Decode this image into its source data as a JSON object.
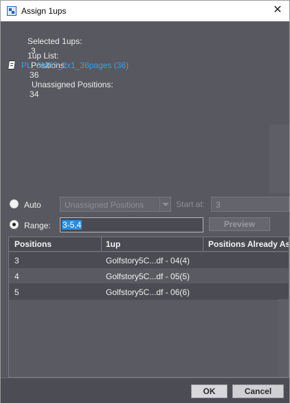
{
  "window": {
    "title": "Assign 1ups",
    "close_glyph": "✕"
  },
  "info": {
    "selected_label": "Selected 1ups:",
    "selected_value": "3",
    "list_label": "1up List:",
    "positions_label": "Positions:",
    "positions_value": "36",
    "unassigned_label": "Unassigned Positions:",
    "unassigned_value": "34"
  },
  "document_link": {
    "text": "PL_SM52_2x1_36pages (36)",
    "icon": "document-icon"
  },
  "auto": {
    "label": "Auto",
    "selected": false,
    "combo_value": "Unassigned Positions",
    "start_at_label": "Start at:",
    "start_at_value": "3"
  },
  "range": {
    "label": "Range:",
    "selected": true,
    "value": "3-5,4",
    "preview_label": "Preview"
  },
  "table": {
    "columns": [
      "Positions",
      "1up",
      "Positions Already Ass"
    ],
    "rows": [
      {
        "position": "3",
        "oneup": "Golfstory5C...df - 04(4)",
        "already": ""
      },
      {
        "position": "4",
        "oneup": "Golfstory5C...df - 05(5)",
        "already": ""
      },
      {
        "position": "5",
        "oneup": "Golfstory5C...df - 06(6)",
        "already": ""
      }
    ]
  },
  "footer": {
    "ok_label": "OK",
    "cancel_label": "Cancel"
  },
  "colors": {
    "dialog_bg": "#585860",
    "link": "#3aa0e8",
    "selection": "#2a8cdc"
  }
}
